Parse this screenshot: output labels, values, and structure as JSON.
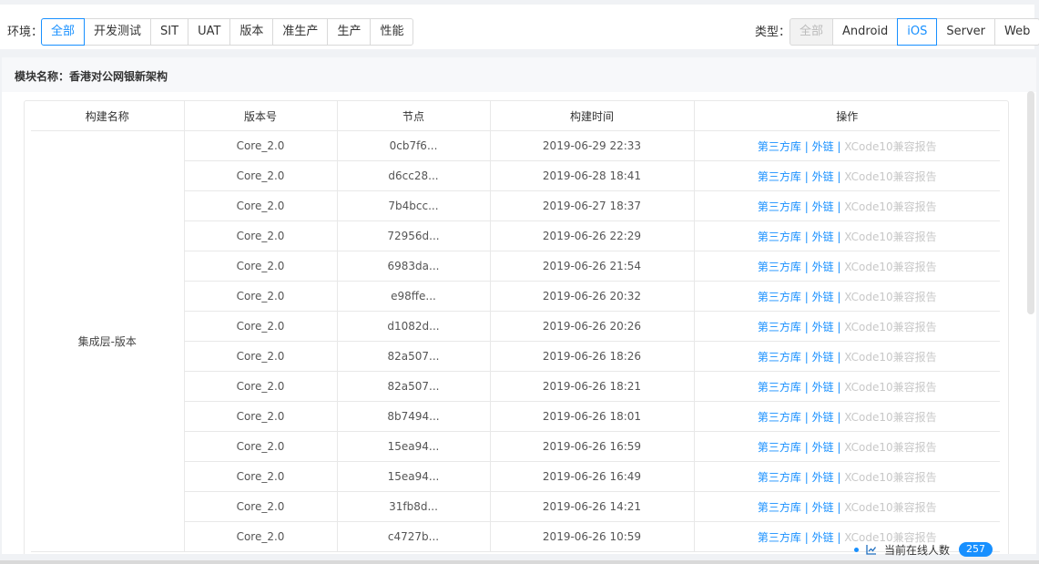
{
  "env": {
    "label": "环境：",
    "options": [
      "全部",
      "开发测试",
      "SIT",
      "UAT",
      "版本",
      "准生产",
      "生产",
      "性能"
    ],
    "active": "全部"
  },
  "type": {
    "label": "类型：",
    "options": [
      "全部",
      "Android",
      "iOS",
      "Server",
      "Web"
    ],
    "active": "iOS",
    "disabled": "全部"
  },
  "module": {
    "title": "模块名称：香港对公网银新架构"
  },
  "table": {
    "headers": [
      "构建名称",
      "版本号",
      "节点",
      "构建时间",
      "操作"
    ],
    "build_name": "集成层-版本",
    "op_third_party": "第三方库",
    "op_sep": " | ",
    "op_chain": "外链",
    "op_report": "XCode10兼容报告",
    "rows": [
      {
        "version": "Core_2.0",
        "node": "0cb7f6...",
        "time": "2019-06-29 22:33"
      },
      {
        "version": "Core_2.0",
        "node": "d6cc28...",
        "time": "2019-06-28 18:41"
      },
      {
        "version": "Core_2.0",
        "node": "7b4bcc...",
        "time": "2019-06-27 18:37"
      },
      {
        "version": "Core_2.0",
        "node": "72956d...",
        "time": "2019-06-26 22:29"
      },
      {
        "version": "Core_2.0",
        "node": "6983da...",
        "time": "2019-06-26 21:54"
      },
      {
        "version": "Core_2.0",
        "node": "e98ffe...",
        "time": "2019-06-26 20:32"
      },
      {
        "version": "Core_2.0",
        "node": "d1082d...",
        "time": "2019-06-26 20:26"
      },
      {
        "version": "Core_2.0",
        "node": "82a507...",
        "time": "2019-06-26 18:26"
      },
      {
        "version": "Core_2.0",
        "node": "82a507...",
        "time": "2019-06-26 18:21"
      },
      {
        "version": "Core_2.0",
        "node": "8b7494...",
        "time": "2019-06-26 18:01"
      },
      {
        "version": "Core_2.0",
        "node": "15ea94...",
        "time": "2019-06-26 16:59"
      },
      {
        "version": "Core_2.0",
        "node": "15ea94...",
        "time": "2019-06-26 16:49"
      },
      {
        "version": "Core_2.0",
        "node": "31fb8d...",
        "time": "2019-06-26 14:21"
      },
      {
        "version": "Core_2.0",
        "node": "c4727b...",
        "time": "2019-06-26 10:59"
      }
    ]
  },
  "online": {
    "label": "当前在线人数",
    "count": "257",
    "icon": "line-chart-icon"
  },
  "colors": {
    "accent": "#1890ff",
    "disabled_text": "#c8c8c8",
    "border": "#e8e8e8"
  }
}
